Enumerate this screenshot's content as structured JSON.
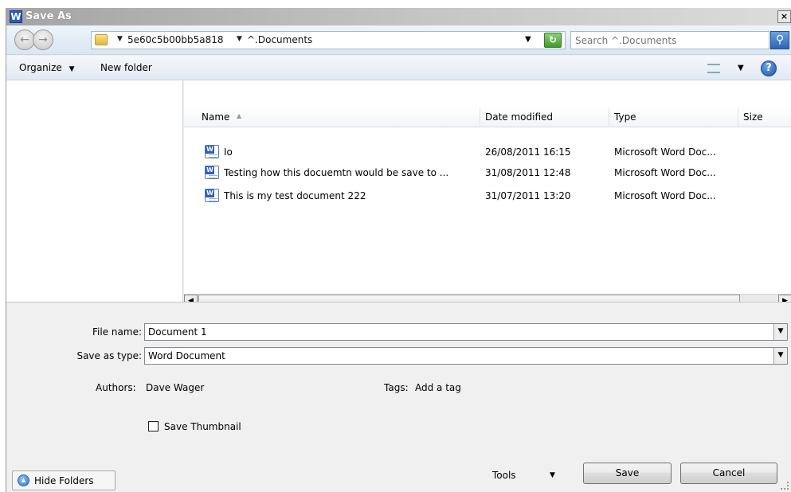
{
  "window": {
    "app_icon_letter": "W",
    "title": "Save As",
    "close_glyph": "×"
  },
  "address": {
    "crumbs": [
      "5e60c5b00bb5a818",
      "^.Documents"
    ],
    "search_placeholder": "Search ^.Documents"
  },
  "toolbar": {
    "organize": "Organize",
    "new_folder": "New folder",
    "help_glyph": "?"
  },
  "columns": {
    "name": "Name",
    "date": "Date modified",
    "type": "Type",
    "size": "Size"
  },
  "files": [
    {
      "name": "Io",
      "date": "26/08/2011 16:15",
      "type": "Microsoft Word Doc..."
    },
    {
      "name": "Testing how this docuemtn would be save to ...",
      "date": "31/08/2011 12:48",
      "type": "Microsoft Word Doc..."
    },
    {
      "name": "This is my test document 222",
      "date": "31/07/2011 13:20",
      "type": "Microsoft Word Doc..."
    }
  ],
  "form": {
    "file_name_label": "File name:",
    "file_name_value": "Document 1",
    "save_type_label": "Save as type:",
    "save_type_value": "Word Document",
    "authors_label": "Authors:",
    "authors_value": "Dave Wager",
    "tags_label": "Tags:",
    "tags_value": "Add a tag",
    "thumbnail_label": "Save Thumbnail"
  },
  "buttons": {
    "hide_folders": "Hide Folders",
    "tools": "Tools",
    "save": "Save",
    "cancel": "Cancel"
  },
  "icons": {
    "app": "word-app-icon",
    "folder": "folder-icon",
    "refresh": "refresh-icon",
    "search": "search-icon",
    "help": "help-icon",
    "file": "word-document-icon"
  },
  "colors": {
    "address_bar": "#dbe6f3",
    "toolbar": "#e2e9f3",
    "panel": "#f0f0f0",
    "refresh": "#3e9a2b",
    "search": "#2d65b5"
  }
}
